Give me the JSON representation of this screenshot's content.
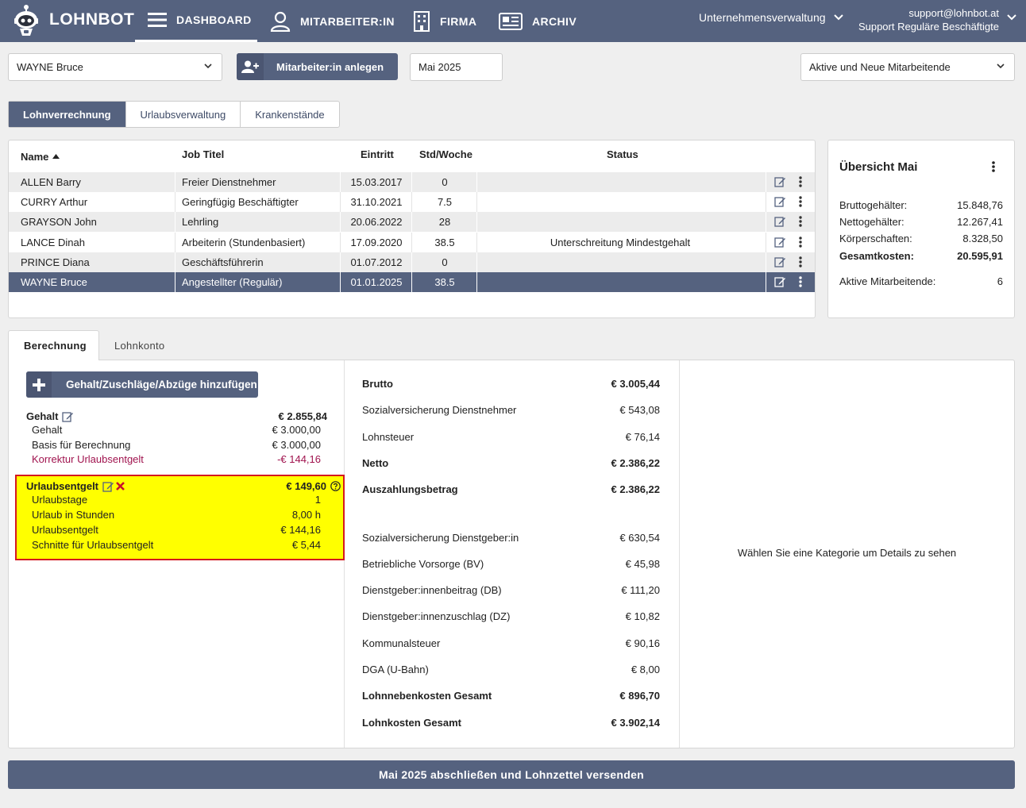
{
  "brand": "LOHNBOT",
  "nav": {
    "dashboard": "DASHBOARD",
    "employees": "MITARBEITER:IN",
    "company": "FIRMA",
    "archive": "ARCHIV"
  },
  "company_menu": "Unternehmensverwaltung",
  "user": {
    "email": "support@lohnbot.at",
    "name": "Support Reguläre Beschäftigte"
  },
  "toolbar": {
    "employee_select": "WAYNE Bruce",
    "create_label": "Mitarbeiter:in anlegen",
    "month": "Mai 2025",
    "filter_select": "Aktive und Neue Mitarbeitende"
  },
  "tabs": [
    "Lohnverrechnung",
    "Urlaubsverwaltung",
    "Krankenstände"
  ],
  "table": {
    "headers": {
      "name": "Name",
      "job": "Job Titel",
      "entry": "Eintritt",
      "hours": "Std/Woche",
      "status": "Status"
    },
    "rows": [
      {
        "name": "ALLEN Barry",
        "job": "Freier Dienstnehmer",
        "entry": "15.03.2017",
        "hours": "0",
        "status": ""
      },
      {
        "name": "CURRY Arthur",
        "job": "Geringfügig Beschäftigter",
        "entry": "31.10.2021",
        "hours": "7.5",
        "status": ""
      },
      {
        "name": "GRAYSON John",
        "job": "Lehrling",
        "entry": "20.06.2022",
        "hours": "28",
        "status": ""
      },
      {
        "name": "LANCE Dinah",
        "job": "Arbeiterin (Stundenbasiert)",
        "entry": "17.09.2020",
        "hours": "38.5",
        "status": "Unterschreitung Mindestgehalt"
      },
      {
        "name": "PRINCE Diana",
        "job": "Geschäftsführerin",
        "entry": "01.07.2012",
        "hours": "0",
        "status": ""
      },
      {
        "name": "WAYNE Bruce",
        "job": "Angestellter (Regulär)",
        "entry": "01.01.2025",
        "hours": "38.5",
        "status": ""
      }
    ]
  },
  "overview": {
    "title": "Übersicht Mai",
    "gross": {
      "label": "Bruttogehälter:",
      "value": "15.848,76"
    },
    "net": {
      "label": "Nettogehälter:",
      "value": "12.267,41"
    },
    "corp": {
      "label": "Körperschaften:",
      "value": "8.328,50"
    },
    "total": {
      "label": "Gesamtkosten:",
      "value": "20.595,91"
    },
    "active": {
      "label": "Aktive Mitarbeitende:",
      "value": "6"
    }
  },
  "lower_tabs": [
    "Berechnung",
    "Lohnkonto"
  ],
  "calc": {
    "add_label": "Gehalt/Zuschläge/Abzüge hinzufügen",
    "salary": {
      "title": "Gehalt",
      "total": "€ 2.855,84",
      "items": [
        {
          "label": "Gehalt",
          "value": "€ 3.000,00"
        },
        {
          "label": "Basis für Berechnung",
          "value": "€ 3.000,00"
        },
        {
          "label": "Korrektur Urlaubsentgelt",
          "value": "-€ 144,16"
        }
      ]
    },
    "vacation": {
      "title": "Urlaubsentgelt",
      "total": "€ 149,60",
      "items": [
        {
          "label": "Urlaubstage",
          "value": "1"
        },
        {
          "label": "Urlaub in Stunden",
          "value": "8,00 h"
        },
        {
          "label": "Urlaubsentgelt",
          "value": "€ 144,16"
        },
        {
          "label": "Schnitte für Urlaubsentgelt",
          "value": "€ 5,44"
        }
      ]
    }
  },
  "summary": [
    {
      "label": "Brutto",
      "value": "€ 3.005,44",
      "bold": true
    },
    {
      "label": "Sozialversicherung Dienstnehmer",
      "value": "€ 543,08",
      "bold": false
    },
    {
      "label": "Lohnsteuer",
      "value": "€ 76,14",
      "bold": false
    },
    {
      "label": "Netto",
      "value": "€ 2.386,22",
      "bold": true
    },
    {
      "label": "Auszahlungsbetrag",
      "value": "€ 2.386,22",
      "bold": true
    },
    {
      "label": "Sozialversicherung Dienstgeber:in",
      "value": "€ 630,54",
      "bold": false
    },
    {
      "label": "Betriebliche Vorsorge (BV)",
      "value": "€ 45,98",
      "bold": false
    },
    {
      "label": "Dienstgeber:innenbeitrag (DB)",
      "value": "€ 111,20",
      "bold": false
    },
    {
      "label": "Dienstgeber:innenzuschlag (DZ)",
      "value": "€ 10,82",
      "bold": false
    },
    {
      "label": "Kommunalsteuer",
      "value": "€ 90,16",
      "bold": false
    },
    {
      "label": "DGA (U-Bahn)",
      "value": "€ 8,00",
      "bold": false
    },
    {
      "label": "Lohnnebenkosten Gesamt",
      "value": "€ 896,70",
      "bold": true
    },
    {
      "label": "Lohnkosten Gesamt",
      "value": "€ 3.902,14",
      "bold": true
    }
  ],
  "details_hint": "Wählen Sie eine Kategorie um Details zu sehen",
  "footer_label": "Mai 2025 abschließen und Lohnzettel versenden",
  "colors": {
    "primary": "#55627f",
    "highlight": "#ffff00",
    "highlight_border": "#d4181f",
    "correction": "#a0134e"
  }
}
